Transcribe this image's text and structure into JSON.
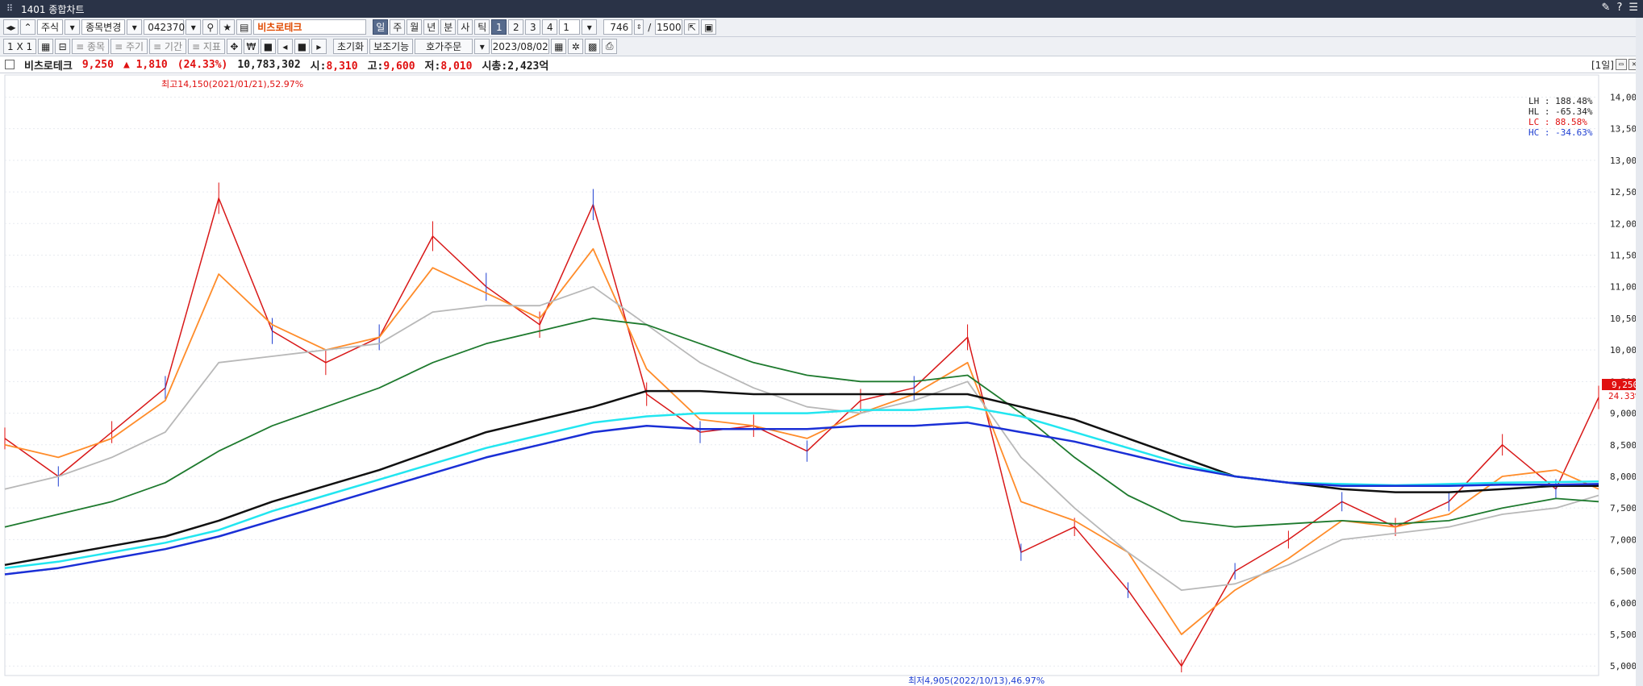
{
  "window": {
    "title": "1401 종합차트"
  },
  "toolbar1": {
    "market": "주식",
    "change_label": "종목변경",
    "code": "042370",
    "stock_name": "비츠로테크",
    "period_buttons": [
      "일",
      "주",
      "월",
      "년",
      "분",
      "사",
      "틱"
    ],
    "number_buttons": [
      "1",
      "2",
      "3",
      "4"
    ],
    "interval_value": "1",
    "count_value": "746",
    "max_count": "1500"
  },
  "toolbar2": {
    "layout_label": "1 X 1",
    "stock_label": "≡ 종목",
    "cycle_label": "≡ 주기",
    "period_label": "≡ 기간",
    "indicator_label": "≡ 지표",
    "won_label": "₩",
    "reset_label": "초기화",
    "aux_label": "보조기능",
    "order_label": "호가주문",
    "date_value": "2023/08/02"
  },
  "infobar": {
    "name": "비츠로테크",
    "price": "9,250",
    "change": "▲ 1,810",
    "change_pct": "(24.33%)",
    "volume": "10,783,302",
    "open_label": "시:",
    "open": "8,310",
    "high_label": "고:",
    "high": "9,600",
    "low_label": "저:",
    "low": "8,010",
    "cap": "시총:2,423억",
    "pane_label": "[1일]"
  },
  "annotations": {
    "high": "최고14,150(2021/01/21),52.97%",
    "low": "최저4,905(2022/10/13),46.97%",
    "lh": "LH : 188.48%",
    "hl": "HL : -65.34%",
    "lc": "LC :  88.58%",
    "hc": "HC : -34.63%",
    "price_tag": "9,250",
    "pct_tag": "24.33%"
  },
  "colors": {
    "up": "#e01010",
    "down": "#1f3fd1",
    "ma5": "#ff4a4a",
    "ma10": "#ff8c2a",
    "ma20": "#ff7ab8",
    "ma60": "#b8b8b8",
    "ma120": "#1e7a2e",
    "ma240": "#111111",
    "ma300": "#22e6f0",
    "ma480": "#1a2fd6"
  },
  "chart_data": {
    "type": "line",
    "title": "",
    "ylim": [
      4850,
      14350
    ],
    "y_ticks": [
      "14,000",
      "13,500",
      "13,000",
      "12,500",
      "12,000",
      "11,500",
      "11,000",
      "10,500",
      "10,000",
      "9,500",
      "9,000",
      "8,500",
      "8,000",
      "7,500",
      "7,000",
      "6,500",
      "6,000",
      "5,500",
      "5,000"
    ],
    "x": [
      0,
      25,
      50,
      75,
      100,
      125,
      150,
      175,
      200,
      225,
      250,
      275,
      300,
      325,
      350,
      375,
      400,
      425,
      450,
      475,
      500,
      525,
      550,
      575,
      600,
      625,
      650,
      675,
      700,
      725,
      745
    ],
    "series": [
      {
        "name": "",
        "color": "#d81818",
        "values": [
          8600,
          8000,
          8700,
          9400,
          12400,
          10300,
          9800,
          10200,
          11800,
          11000,
          10400,
          12300,
          9300,
          8700,
          8800,
          8400,
          9200,
          9400,
          10200,
          6800,
          7200,
          6200,
          5000,
          6500,
          7000,
          7600,
          7200,
          7600,
          8500,
          7800,
          9250
        ]
      },
      {
        "name": "",
        "color": "#ff8c2a",
        "values": [
          8500,
          8300,
          8600,
          9200,
          11200,
          10400,
          10000,
          10200,
          11300,
          10900,
          10500,
          11600,
          9700,
          8900,
          8800,
          8600,
          9000,
          9300,
          9800,
          7600,
          7300,
          6800,
          5500,
          6200,
          6700,
          7300,
          7200,
          7400,
          8000,
          8100,
          7800
        ]
      },
      {
        "name": "",
        "color": "#b8b8b8",
        "values": [
          7800,
          8000,
          8300,
          8700,
          9800,
          9900,
          10000,
          10100,
          10600,
          10700,
          10700,
          11000,
          10400,
          9800,
          9400,
          9100,
          9000,
          9200,
          9500,
          8300,
          7500,
          6800,
          6200,
          6300,
          6600,
          7000,
          7100,
          7200,
          7400,
          7500,
          7700
        ]
      },
      {
        "name": "",
        "color": "#1e7a2e",
        "values": [
          7200,
          7400,
          7600,
          7900,
          8400,
          8800,
          9100,
          9400,
          9800,
          10100,
          10300,
          10500,
          10400,
          10100,
          9800,
          9600,
          9500,
          9500,
          9600,
          9000,
          8300,
          7700,
          7300,
          7200,
          7250,
          7300,
          7250,
          7300,
          7500,
          7650,
          7600
        ]
      },
      {
        "name": "",
        "color": "#111111",
        "values": [
          6600,
          6750,
          6900,
          7050,
          7300,
          7600,
          7850,
          8100,
          8400,
          8700,
          8900,
          9100,
          9350,
          9350,
          9300,
          9300,
          9300,
          9300,
          9300,
          9100,
          8900,
          8600,
          8300,
          8000,
          7900,
          7800,
          7750,
          7750,
          7800,
          7850,
          7850
        ]
      },
      {
        "name": "",
        "color": "#22e6f0",
        "values": [
          6550,
          6650,
          6800,
          6950,
          7150,
          7450,
          7700,
          7950,
          8200,
          8450,
          8650,
          8850,
          8950,
          9000,
          9000,
          9000,
          9050,
          9050,
          9100,
          8950,
          8700,
          8450,
          8200,
          8000,
          7900,
          7880,
          7860,
          7880,
          7900,
          7910,
          7920
        ]
      },
      {
        "name": "",
        "color": "#1a2fd6",
        "values": [
          6450,
          6550,
          6700,
          6850,
          7050,
          7300,
          7550,
          7800,
          8050,
          8300,
          8500,
          8700,
          8800,
          8750,
          8750,
          8750,
          8800,
          8800,
          8850,
          8700,
          8550,
          8350,
          8150,
          8000,
          7900,
          7850,
          7850,
          7850,
          7870,
          7870,
          7880
        ]
      }
    ]
  }
}
